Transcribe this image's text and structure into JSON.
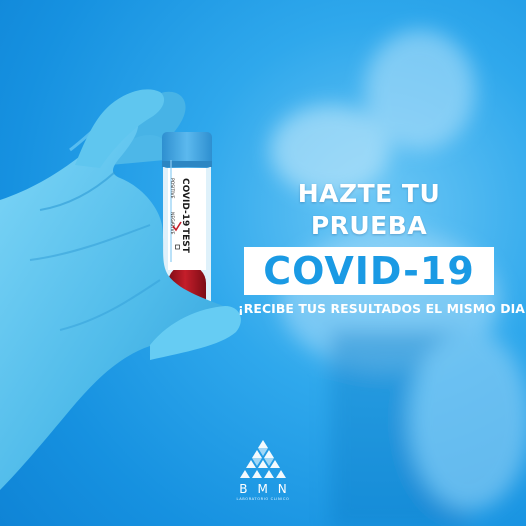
{
  "poster": {
    "headline": "HAZTE TU PRUEBA",
    "highlight": "COVID-19",
    "subheadline": "¡RECIBE TUS RESULTADOS EL MISMO DIA!"
  },
  "tube": {
    "title": "COVID-19",
    "test": "TEST",
    "positive": "POSITIVE",
    "negative": "NEGATIVE"
  },
  "logo": {
    "name": "BMN",
    "tagline": "LABORATORIO CLINICO"
  },
  "colors": {
    "background": "#1691e0",
    "glove": "#58c3f0",
    "cap": "#3aa2e0",
    "blood": "#b21522",
    "text": "#ffffff",
    "highlight_text": "#1a9ae4"
  },
  "icons": [
    "bmn-pyramid-logo-icon",
    "checkmark-icon"
  ]
}
